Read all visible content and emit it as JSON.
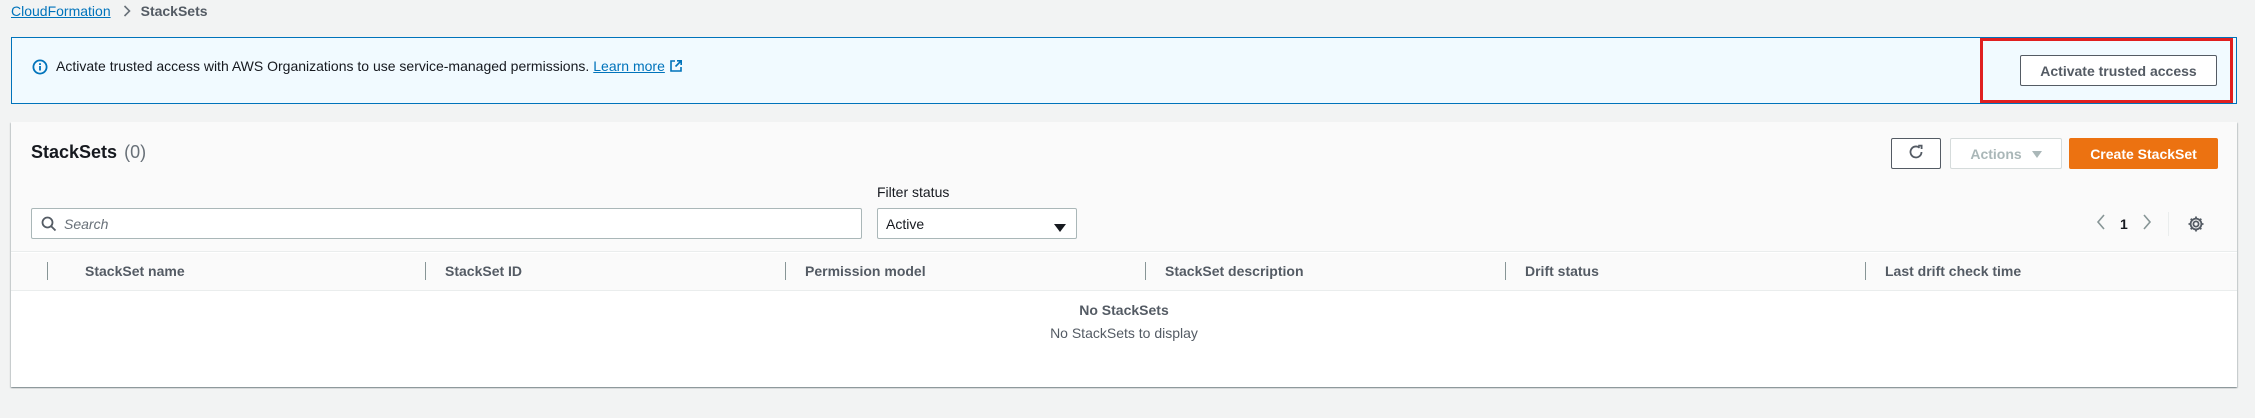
{
  "breadcrumb": {
    "parent": "CloudFormation",
    "current": "StackSets"
  },
  "flash": {
    "message": "Activate trusted access with AWS Organizations to use service-managed permissions.",
    "link": "Learn more",
    "button": "Activate trusted access",
    "icon": "info-icon",
    "link_icon": "external-link-icon"
  },
  "panel": {
    "title": "StackSets",
    "count": "(0)",
    "actions_label": "Actions",
    "create_label": "Create StackSet",
    "refresh_icon": "refresh-icon"
  },
  "search": {
    "placeholder": "Search",
    "value": ""
  },
  "filter": {
    "label": "Filter status",
    "selected": "Active"
  },
  "pagination": {
    "current_page": "1"
  },
  "table": {
    "columns": [
      "StackSet name",
      "StackSet ID",
      "Permission model",
      "StackSet description",
      "Drift status",
      "Last drift check time"
    ],
    "rows": [],
    "empty_title": "No StackSets",
    "empty_message": "No StackSets to display"
  },
  "colors": {
    "link": "#0073bb",
    "primary": "#ec7211",
    "info_bg": "#f1faff",
    "highlight": "#e02020"
  }
}
